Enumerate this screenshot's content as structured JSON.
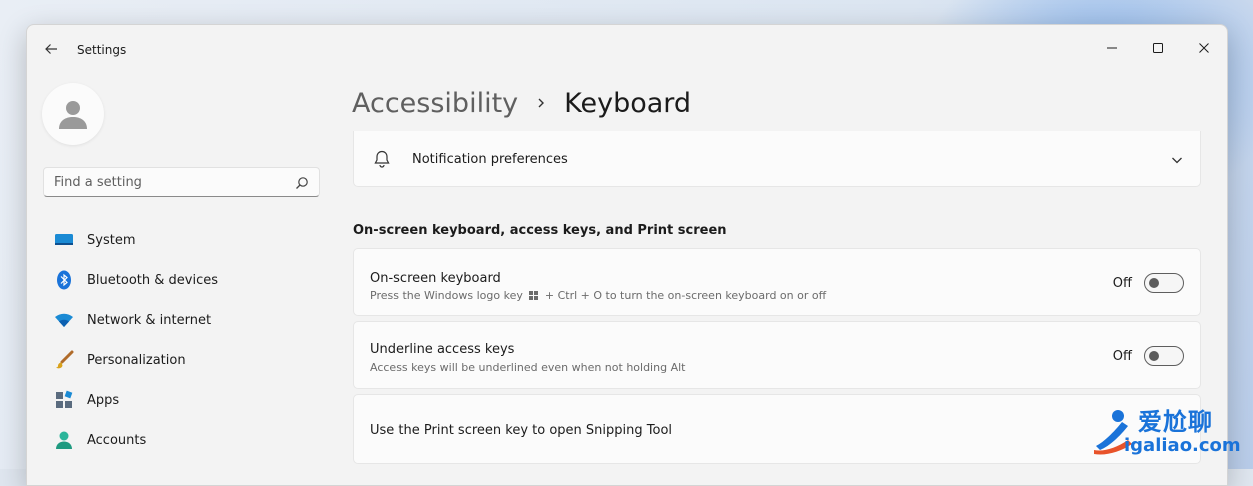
{
  "window": {
    "title": "Settings"
  },
  "search": {
    "placeholder": "Find a setting"
  },
  "sidebar": {
    "items": [
      {
        "label": "System",
        "icon": "system-icon"
      },
      {
        "label": "Bluetooth & devices",
        "icon": "bluetooth-icon"
      },
      {
        "label": "Network & internet",
        "icon": "wifi-icon"
      },
      {
        "label": "Personalization",
        "icon": "brush-icon"
      },
      {
        "label": "Apps",
        "icon": "apps-icon"
      },
      {
        "label": "Accounts",
        "icon": "accounts-icon"
      }
    ]
  },
  "breadcrumb": {
    "parent": "Accessibility",
    "current": "Keyboard"
  },
  "main": {
    "notification_card": {
      "label": "Notification preferences"
    },
    "section_heading": "On-screen keyboard, access keys, and Print screen",
    "settings": [
      {
        "title": "On-screen keyboard",
        "description_before": "Press the Windows logo key",
        "description_after": "+ Ctrl + O to turn the on-screen keyboard on or off",
        "state": "Off"
      },
      {
        "title": "Underline access keys",
        "description": "Access keys will be underlined even when not holding Alt",
        "state": "Off"
      },
      {
        "title": "Use the Print screen key to open Snipping Tool"
      }
    ]
  },
  "watermark": {
    "text_top": "爱尬聊",
    "text_bottom": "igaliao.com"
  },
  "colors": {
    "accent": "#0067c0",
    "toggle_off_border": "#5e5e5e"
  }
}
